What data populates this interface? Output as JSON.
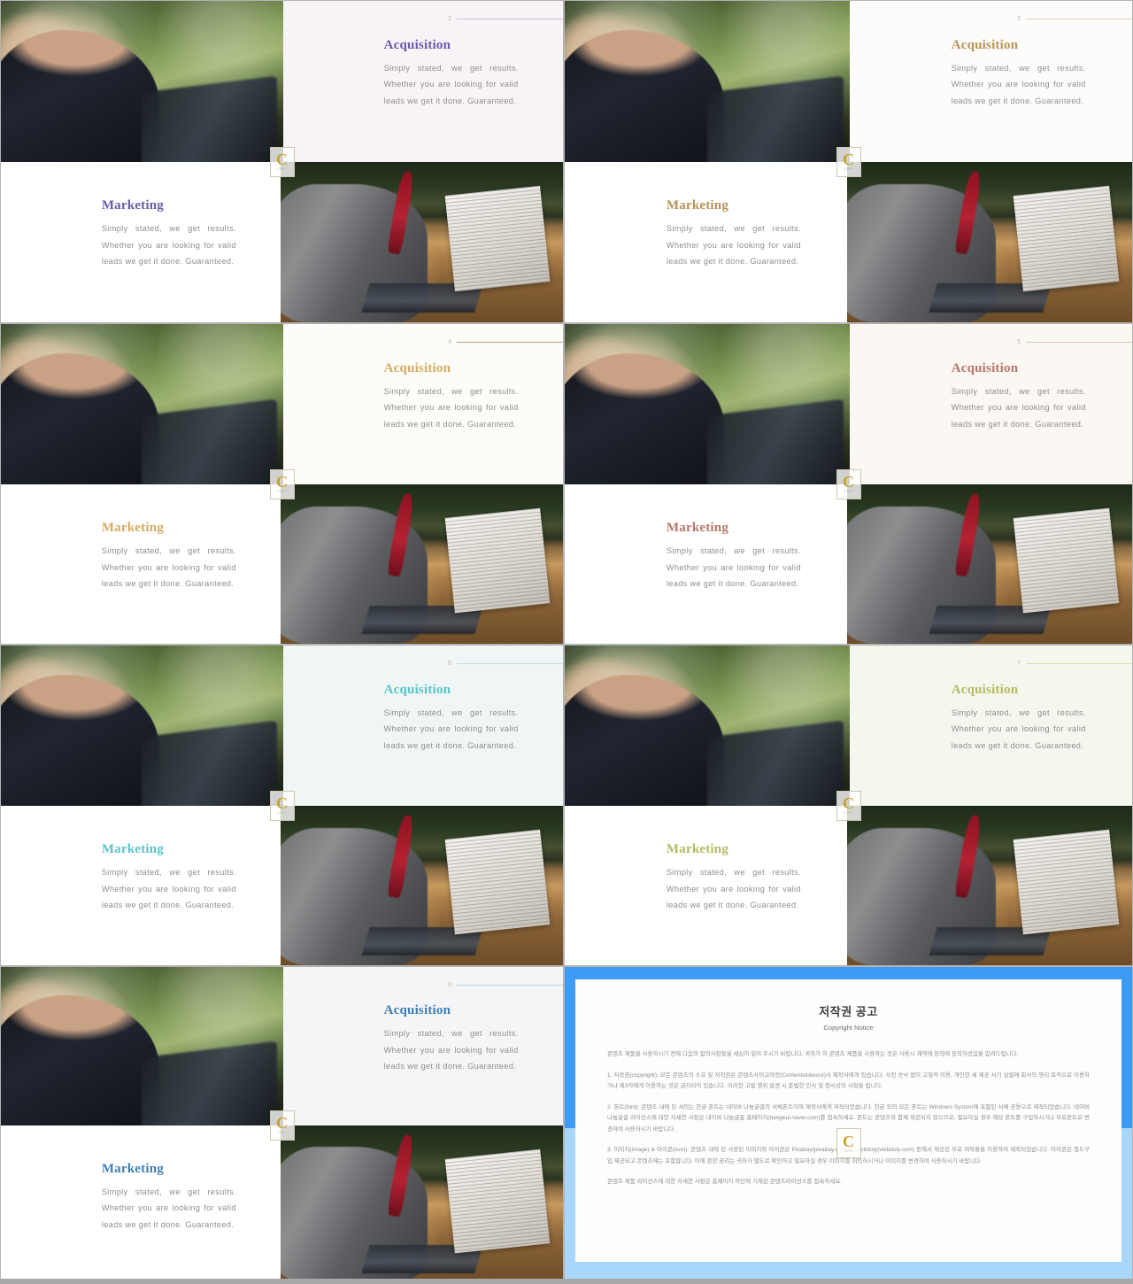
{
  "deck": {
    "body_text": "Simply stated, we get results. Whether you are looking for valid leads we get it done. Guaranteed.",
    "heading_top": "Acquisition",
    "heading_bottom": "Marketing",
    "slides": [
      {
        "number": "2",
        "accent": "#6a5aa8",
        "rule": "#c9bfdf",
        "bg": "#f7f3f7",
        "top_heading": "Acquisition",
        "bottom_heading": "Marketing"
      },
      {
        "number": "3",
        "accent": "#b79355",
        "rule": "#ddd0b3",
        "bg": "#fdfcfa",
        "top_heading": "Acquisition",
        "bottom_heading": "Marketing"
      },
      {
        "number": "4",
        "accent": "#d4ab62",
        "rule": "#b99b86",
        "bg": "#fdfcf8",
        "top_heading": "Acquisition",
        "bottom_heading": "Marketing"
      },
      {
        "number": "5",
        "accent": "#b5776a",
        "rule": "#dcc3b8",
        "bg": "#fbf7f3",
        "top_heading": "Acquisition",
        "bottom_heading": "Marketing"
      },
      {
        "number": "6",
        "accent": "#5bc4c8",
        "rule": "#b6e3e4",
        "bg": "#f0f6f5",
        "top_heading": "Acquisition",
        "bottom_heading": "Marketing"
      },
      {
        "number": "7",
        "accent": "#b4bb62",
        "rule": "#d6dbb0",
        "bg": "#f5f7ef",
        "top_heading": "Acquisition",
        "bottom_heading": "Marketing"
      },
      {
        "number": "8",
        "accent": "#3f7fb5",
        "rule": "#bcd0e0",
        "bg": "#f5f5f8",
        "top_heading": "Acquisition",
        "bottom_heading": "Marketing"
      }
    ],
    "watermark": {
      "letter": "C",
      "caption": "COPY"
    }
  },
  "copyright": {
    "title": "저작권 공고",
    "subtitle": "Copyright Notice",
    "intro": "콘텐츠 제품을 사용하시기 전에 다음의 합의사항들을 세심히 읽어 주시기 바랍니다. 귀하가 이 콘텐츠 제품을 사용하는 것은 사용시 계약에 동의에 동의하셨음을 알려드립니다.",
    "sections": [
      "1. 저작권(copyright): 모든 콘텐츠의 소유 및 저작권은 콘텐츠사이고야컷(Contentstokeout)사 제작사에게 있습니다. 사전 승낙 없이 고칠적 이용, 개인한 세 제공 서기 심벌에 회사의 영리 목적으로 이용하거나 제3자에게 이용하는 것은 금지되어 있습니다. 이러한 고발 행위 발견 시 준법한 민사 및 형사상의 사항을 됩니다.",
      "2. 폰트(font): 콘텐츠 내에 된 서의는 한글 폰트는 네이버 나눔글꼴의 서체폰트이며 제작사에게 저작되었습니다. 한글 외의 모든 폰트는 Windows System에 포함된 서체 공용으로 제작되었습니다. 네이버 나눔글꼴 라이선스에 대한 자세한 사항은 네이버 나눔글꼴 홈페이지(hangeul.naver.com)를 접속하세요. 폰트는 콘텐츠와 함께 제공되지 않으므로, 필요하실 경우 해당 폰트를 구입하시거나 무료폰트로 변경하여 사용하시기 바랍니다.",
      "3. 이미지(image) & 아이콘(icon): 콘텐츠 내에 된 사용된 이미지와 아이콘은 Pixabay(pixabay.com)와 Webdoly(webdoly.com) 등에서 제공된 무료 저작물을 이용하여 제작되었습니다. 아이콘은 별도구입 제공되고 콘텐츠에는 포함합니다. 이에 관한 권리는 귀하가 별도로 확인하고 필요하실 경우 이미지를 취득하시거나 이미지를 변경하여 사용하시기 바랍니다.",
      "콘텐츠 제품 라이선스에 대한 자세한 사항은 홈페이지 하단에 기재된 콘텐츠라이선스를 접속하세요."
    ]
  }
}
